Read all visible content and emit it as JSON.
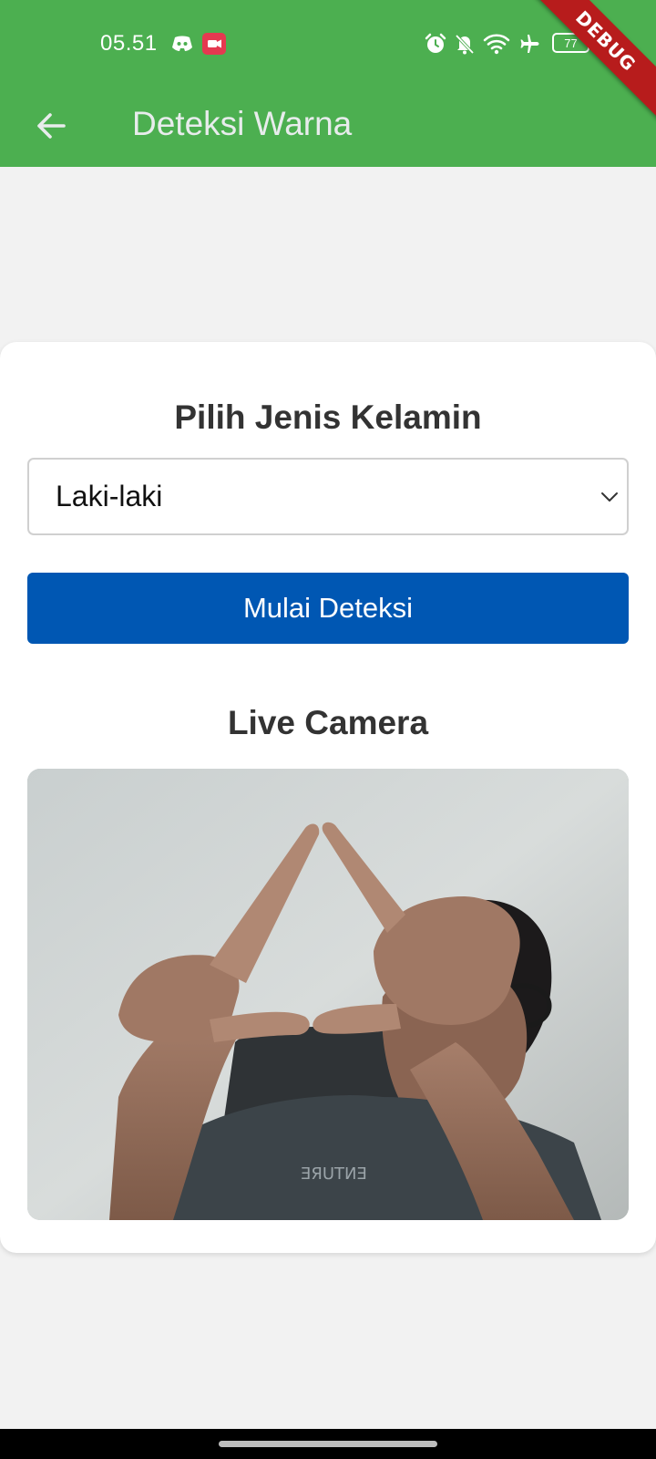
{
  "status_bar": {
    "time": "05.51",
    "battery_level": "77",
    "debug_label": "DEBUG",
    "left_icons": [
      "discord-icon",
      "screen-recorder-icon"
    ],
    "right_icons": [
      "alarm-icon",
      "notifications-off-icon",
      "wifi-icon",
      "airplane-mode-icon",
      "battery-icon"
    ]
  },
  "app_bar": {
    "title": "Deteksi Warna",
    "back_icon": "arrow-back-icon",
    "background_color": "#4caf50"
  },
  "form": {
    "gender_section_title": "Pilih Jenis Kelamin",
    "gender_selected": "Laki-laki",
    "start_button_label": "Mulai Deteksi",
    "start_button_color": "#0057b3"
  },
  "camera": {
    "section_title": "Live Camera"
  }
}
